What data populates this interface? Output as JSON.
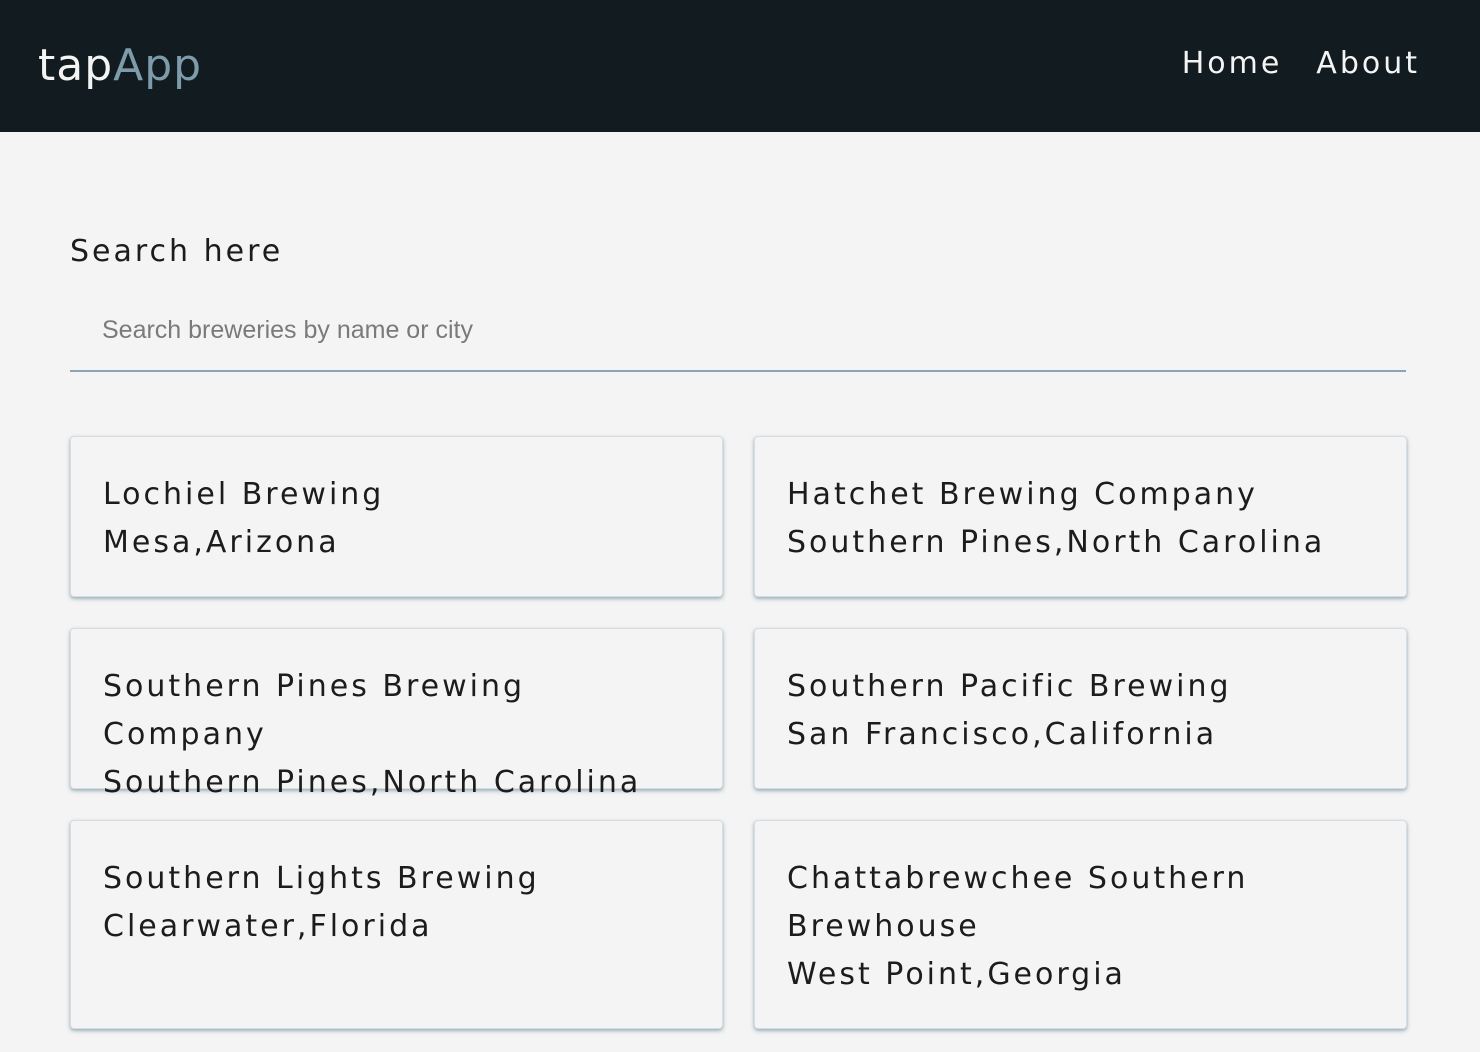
{
  "navbar": {
    "logo_part1": "tap",
    "logo_part2": "App",
    "links": [
      "Home",
      "About"
    ]
  },
  "search": {
    "label": "Search here",
    "placeholder": "Search breweries by name or city",
    "value": ""
  },
  "breweries": [
    {
      "name": "Lochiel Brewing",
      "location": "Mesa,Arizona"
    },
    {
      "name": "Hatchet Brewing Company",
      "location": "Southern Pines,North Carolina"
    },
    {
      "name": "Southern Pines Brewing Company",
      "location": "Southern Pines,North Carolina"
    },
    {
      "name": "Southern Pacific Brewing",
      "location": "San Francisco,California"
    },
    {
      "name": "Southern Lights Brewing",
      "location": "Clearwater,Florida"
    },
    {
      "name": "Chattabrewchee Southern Brewhouse",
      "location": "West Point,Georgia"
    }
  ],
  "colors": {
    "navbar_bg": "#121b1f",
    "logo_accent": "#7e9bab",
    "page_bg": "#f4f4f4",
    "input_underline": "#8aa6b6"
  }
}
